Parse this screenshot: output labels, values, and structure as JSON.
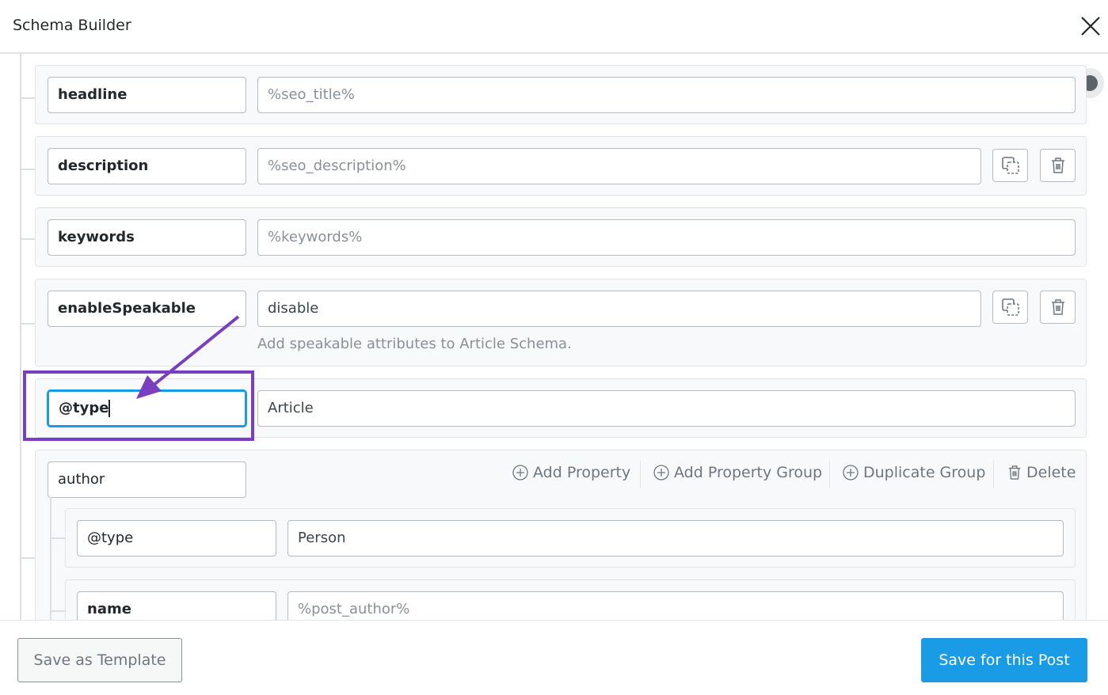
{
  "header": {
    "title": "Schema Builder",
    "close_icon": "close-icon"
  },
  "rows": [
    {
      "key": "headline",
      "value": "%seo_title%",
      "placeholder": true
    },
    {
      "key": "description",
      "value": "%seo_description%",
      "placeholder": true
    },
    {
      "key": "keywords",
      "value": "%keywords%",
      "placeholder": true
    },
    {
      "key": "enableSpeakable",
      "value": "disable",
      "help": "Add speakable attributes to Article Schema."
    },
    {
      "key": "@type",
      "value": "Article"
    }
  ],
  "group": {
    "key": "author",
    "actions": {
      "add_property": "Add Property",
      "add_property_group": "Add Property Group",
      "duplicate_group": "Duplicate Group",
      "delete": "Delete"
    },
    "rows": [
      {
        "key": "@type",
        "value": "Person"
      },
      {
        "key": "name",
        "value": "%post_author%",
        "placeholder": true
      }
    ]
  },
  "footer": {
    "save_template": "Save as Template",
    "save_post": "Save for this Post"
  },
  "colors": {
    "accent": "#1a9be6",
    "annotation": "#7a3fc0"
  }
}
